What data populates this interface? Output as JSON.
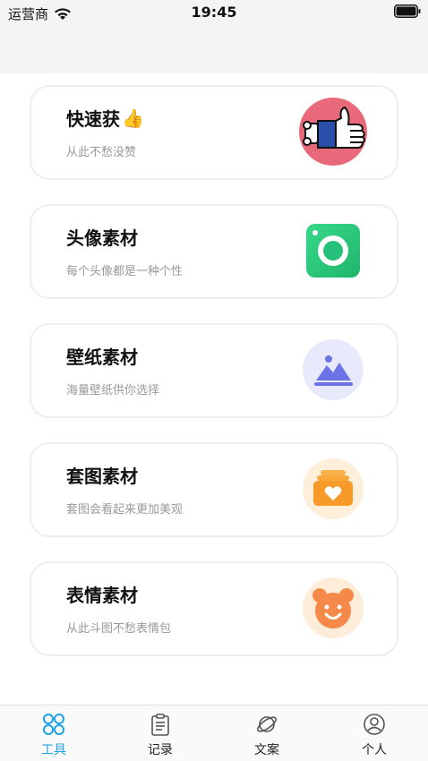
{
  "status_bar": {
    "carrier": "运营商",
    "time": "19:45"
  },
  "cards": [
    {
      "title": "快速获",
      "emoji": "👍",
      "subtitle": "从此不愁没赞",
      "icon": "thumbs-up-icon"
    },
    {
      "title": "头像素材",
      "emoji": "",
      "subtitle": "每个头像都是一种个性",
      "icon": "camera-icon"
    },
    {
      "title": "壁纸素材",
      "emoji": "",
      "subtitle": "海量壁纸供你选择",
      "icon": "landscape-icon"
    },
    {
      "title": "套图素材",
      "emoji": "",
      "subtitle": "套图会看起来更加美观",
      "icon": "heart-album-icon"
    },
    {
      "title": "表情素材",
      "emoji": "",
      "subtitle": "从此斗图不愁表情包",
      "icon": "bear-face-icon"
    }
  ],
  "tabs": [
    {
      "label": "工具",
      "icon": "grid-circles-icon",
      "active": true
    },
    {
      "label": "记录",
      "icon": "clipboard-icon",
      "active": false
    },
    {
      "label": "文案",
      "icon": "planet-icon",
      "active": false
    },
    {
      "label": "个人",
      "icon": "user-icon",
      "active": false
    }
  ],
  "colors": {
    "accent": "#1ea2e6",
    "card_border": "#eeeeee",
    "subtitle": "#9a9a9a"
  }
}
